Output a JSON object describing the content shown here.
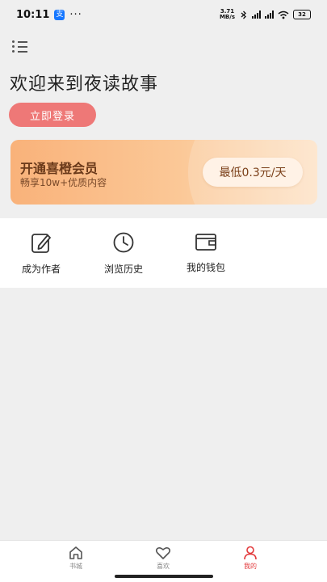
{
  "status_bar": {
    "time": "10:11",
    "pay_badge": "支",
    "more": "···",
    "net_speed_value": "3.71",
    "net_speed_unit": "MB/s",
    "battery": "32"
  },
  "header": {
    "menu_icon": "list-menu-icon",
    "welcome_title": "欢迎来到夜读故事",
    "login_label": "立即登录"
  },
  "vip_banner": {
    "title": "开通喜橙会员",
    "subtitle": "畅享10w+优质内容",
    "price_label": "最低0.3元/天",
    "gradient_start": "#f9b27a",
    "gradient_end": "#fde2c6"
  },
  "shortcuts": [
    {
      "label": "成为作者",
      "icon": "edit-icon"
    },
    {
      "label": "浏览历史",
      "icon": "clock-icon"
    },
    {
      "label": "我的钱包",
      "icon": "wallet-icon"
    }
  ],
  "bottom_nav": {
    "items": [
      {
        "label": "书城",
        "icon": "home-icon"
      },
      {
        "label": "喜欢",
        "icon": "heart-icon"
      },
      {
        "label": "我的",
        "icon": "user-icon"
      }
    ],
    "active_color": "#e2383a",
    "active_item": "我的"
  },
  "colors": {
    "login_button": "#ee7877",
    "background": "#efefef"
  }
}
